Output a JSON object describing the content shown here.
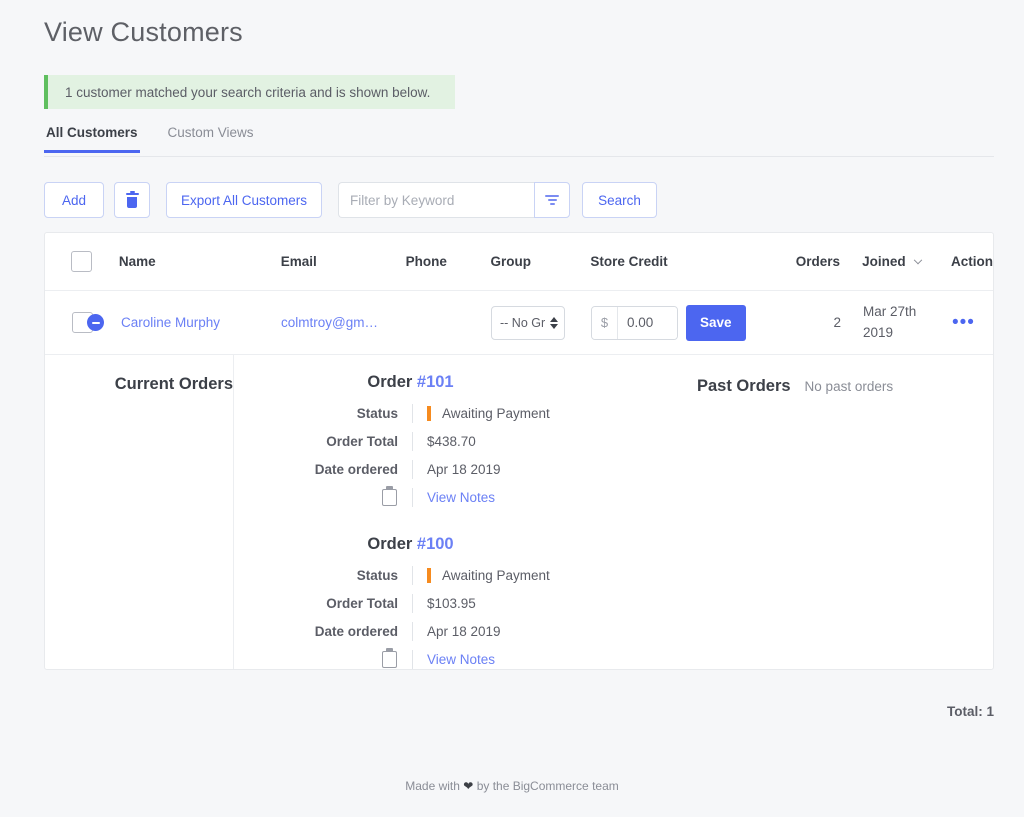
{
  "header": {
    "title": "View Customers"
  },
  "alert": {
    "message": "1 customer matched your search criteria and is shown below.",
    "accent_color": "#5fbf5f",
    "background_color": "#e2f2e2"
  },
  "tabs": [
    {
      "label": "All Customers",
      "active": true
    },
    {
      "label": "Custom Views",
      "active": false
    }
  ],
  "toolbar": {
    "add_label": "Add",
    "delete_icon": "trash-icon",
    "export_label": "Export All Customers",
    "search_placeholder": "Filter by Keyword",
    "search_value": "",
    "filter_icon": "filter-icon",
    "search_label": "Search"
  },
  "table": {
    "columns": [
      "Name",
      "Email",
      "Phone",
      "Group",
      "Store Credit",
      "Orders",
      "Joined",
      "Action"
    ],
    "sorted_column": "Joined",
    "rows": [
      {
        "name": "Caroline Murphy",
        "email": "colmtroy@gm…",
        "phone": "",
        "group": "-- No Gr",
        "credit_symbol": "$",
        "credit_value": "0.00",
        "save_label": "Save",
        "orders": "2",
        "joined_line1": "Mar 27th",
        "joined_line2": "2019",
        "action_icon": "ellipsis-icon"
      }
    ]
  },
  "expanded": {
    "current_orders_heading": "Current Orders",
    "past_orders_heading": "Past Orders",
    "no_past_orders": "No past orders",
    "labels": {
      "status": "Status",
      "order_total": "Order Total",
      "date_ordered": "Date ordered",
      "notes_icon": "clipboard-icon",
      "notes_link": "View Notes"
    },
    "orders": [
      {
        "title_prefix": "Order",
        "number": "#101",
        "status": "Awaiting Payment",
        "status_color": "#f68b1f",
        "total": "$438.70",
        "date": "Apr 18 2019",
        "notes_link": "View Notes"
      },
      {
        "title_prefix": "Order",
        "number": "#100",
        "status": "Awaiting Payment",
        "status_color": "#f68b1f",
        "total": "$103.95",
        "date": "Apr 18 2019",
        "notes_link": "View Notes"
      }
    ]
  },
  "footer": {
    "total_label": "Total: 1",
    "made_with_prefix": "Made with",
    "made_with_suffix": "by the BigCommerce team"
  },
  "colors": {
    "primary": "#4c66f0",
    "link": "#6b80f5",
    "status_orange": "#f68b1f",
    "success_green": "#5fbf5f"
  }
}
